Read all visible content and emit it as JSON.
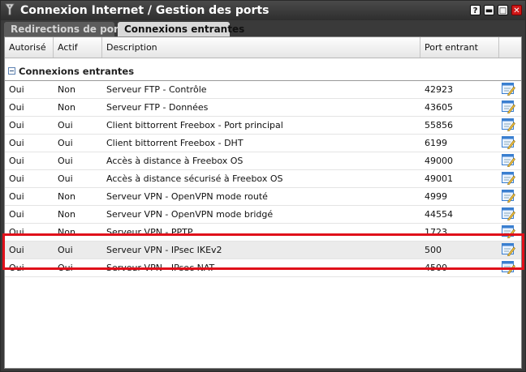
{
  "window": {
    "title": "Connexion Internet / Gestion des ports",
    "controls": {
      "help": "?",
      "minimize": "▬",
      "maximize": "□",
      "close": "✕"
    }
  },
  "tabs": [
    {
      "label": "Redirections de ports",
      "active": false
    },
    {
      "label": "Connexions entrantes",
      "active": true
    }
  ],
  "columns": [
    "Autorisé",
    "Actif",
    "Description",
    "Port entrant",
    ""
  ],
  "group": {
    "label": "Connexions entrantes",
    "expanded": true
  },
  "rows": [
    {
      "autorise": "Oui",
      "actif": "Non",
      "description": "Serveur FTP - Contrôle",
      "port": "42923"
    },
    {
      "autorise": "Oui",
      "actif": "Non",
      "description": "Serveur FTP - Données",
      "port": "43605"
    },
    {
      "autorise": "Oui",
      "actif": "Oui",
      "description": "Client bittorrent Freebox - Port principal",
      "port": "55856"
    },
    {
      "autorise": "Oui",
      "actif": "Oui",
      "description": "Client bittorrent Freebox - DHT",
      "port": "6199"
    },
    {
      "autorise": "Oui",
      "actif": "Oui",
      "description": "Accès à distance à Freebox OS",
      "port": "49000"
    },
    {
      "autorise": "Oui",
      "actif": "Oui",
      "description": "Accès à distance sécurisé à Freebox OS",
      "port": "49001"
    },
    {
      "autorise": "Oui",
      "actif": "Non",
      "description": "Serveur VPN - OpenVPN mode routé",
      "port": "4999"
    },
    {
      "autorise": "Oui",
      "actif": "Non",
      "description": "Serveur VPN - OpenVPN mode bridgé",
      "port": "44554"
    },
    {
      "autorise": "Oui",
      "actif": "Non",
      "description": "Serveur VPN - PPTP",
      "port": "1723"
    },
    {
      "autorise": "Oui",
      "actif": "Oui",
      "description": "Serveur VPN - IPsec IKEv2",
      "port": "500",
      "selected": true
    },
    {
      "autorise": "Oui",
      "actif": "Oui",
      "description": "Serveur VPN - IPsec NAT",
      "port": "4500"
    }
  ],
  "colors": {
    "accent": "#e0101a",
    "titlebar": "#2e2e2e",
    "edit_icon": "#3a7fd0"
  },
  "icons": {
    "row_action": "edit-icon",
    "app": "router-icon"
  }
}
